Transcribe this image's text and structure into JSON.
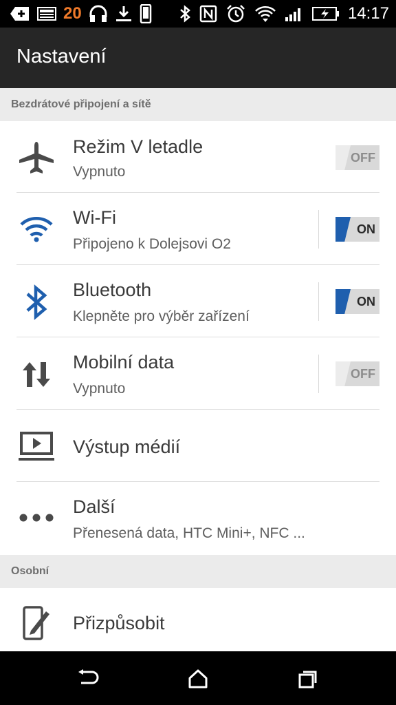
{
  "status_bar": {
    "notification_count": "20",
    "time": "14:17"
  },
  "app_bar": {
    "title": "Nastavení"
  },
  "sections": {
    "wireless": {
      "label": "Bezdrátové připojení a sítě"
    },
    "personal": {
      "label": "Osobní"
    }
  },
  "items": {
    "airplane": {
      "title": "Režim V letadle",
      "subtitle": "Vypnuto",
      "toggle": "OFF",
      "icon": "airplane-icon"
    },
    "wifi": {
      "title": "Wi-Fi",
      "subtitle": "Připojeno k Dolejsovi O2",
      "toggle": "ON",
      "icon": "wifi-icon"
    },
    "bluetooth": {
      "title": "Bluetooth",
      "subtitle": "Klepněte pro výběr zařízení",
      "toggle": "ON",
      "icon": "bluetooth-icon"
    },
    "mobile_data": {
      "title": "Mobilní data",
      "subtitle": "Vypnuto",
      "toggle": "OFF",
      "icon": "mobile-data-icon"
    },
    "media_output": {
      "title": "Výstup médií",
      "icon": "media-output-icon"
    },
    "more": {
      "title": "Další",
      "subtitle": "Přenesená data, HTC Mini+, NFC ...",
      "icon": "more-icon"
    },
    "personalize": {
      "title": "Přizpůsobit",
      "icon": "personalize-icon"
    }
  },
  "colors": {
    "accent_blue": "#1f5fae",
    "app_bar": "#262626",
    "section_bg": "#ebebeb"
  }
}
